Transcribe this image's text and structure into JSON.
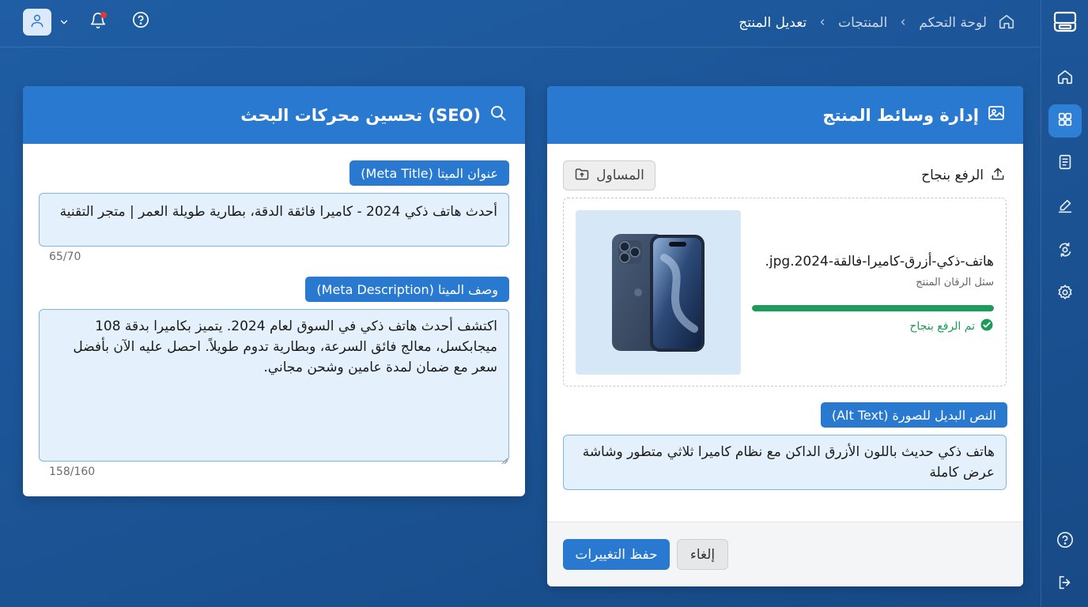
{
  "breadcrumb": {
    "home": "لوحة التحكم",
    "products": "المنتجات",
    "current": "تعديل المنتج"
  },
  "icons": {
    "logo": "app-logo-icon",
    "home": "home-icon",
    "notifications": "bell-icon",
    "help": "help-icon",
    "user": "user-icon"
  },
  "colors": {
    "accent": "#2a79d0",
    "success": "#1e9b5a",
    "notification_dot": "#e53935"
  },
  "media_card": {
    "title": "إدارة وسائط المنتج",
    "upload_status_label": "الرفع بنجاح",
    "drafts_button": "المساول",
    "file_name": "هاتف-ذكي-أزرق-كاميرا-فالقة-2024.jpg.",
    "file_subtitle": "سثل الرقان المنتج",
    "upload_progress": 1.0,
    "upload_done_text": "تم الرفع بنجاح",
    "alt_text_label": "النص البديل للصورة (Alt Text)",
    "alt_text_value": "هاتف ذكي حديث باللون الأزرق الداكن مع نظام كاميرا ثلاثي متطور وشاشة عرض كاملة",
    "save_button": "حفظ التغييرات",
    "cancel_button": "إلغاء"
  },
  "seo_card": {
    "title": "تحسين محركات البحث (SEO)",
    "meta_title_label": "عنوان الميتا (Meta Title)",
    "meta_title_value": "أحدث هاتف ذكي 2024 - كاميرا فائقة الدقة، بطارية طويلة العمر | متجر التقنية",
    "meta_title_counter": "65/70",
    "meta_desc_label": "وصف الميتا (Meta Description)",
    "meta_desc_value": "اكتشف أحدث هاتف ذكي في السوق لعام 2024. يتميز بكاميرا بدقة 108 ميجابكسل، معالج فائق السرعة، وبطارية تدوم طويلاً. احصل عليه الآن بأفضل سعر مع ضمان لمدة عامين وشحن مجاني.",
    "meta_desc_counter": "158/160"
  }
}
